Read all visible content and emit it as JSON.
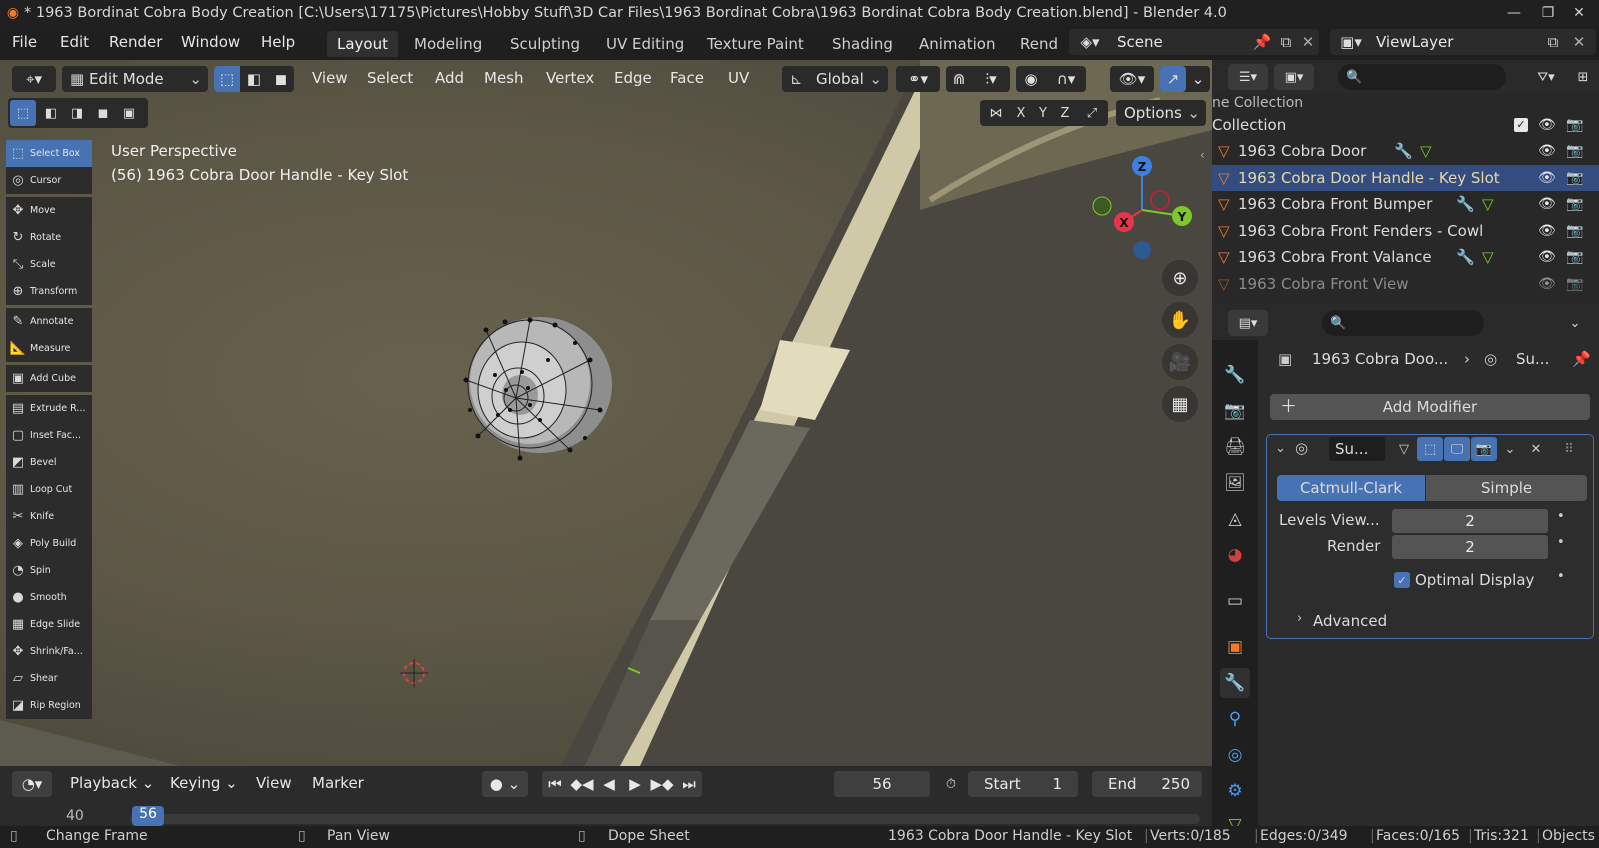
{
  "window": {
    "title": "* 1963 Bordinat Cobra Body Creation [C:\\Users\\17175\\Pictures\\Hobby Stuff\\3D Car Files\\1963 Bordinat Cobra\\1963 Bordinat Cobra Body Creation.blend] - Blender 4.0",
    "controls": [
      "—",
      "❐",
      "✕"
    ]
  },
  "menu": [
    "File",
    "Edit",
    "Render",
    "Window",
    "Help"
  ],
  "workspaces": [
    "Layout",
    "Modeling",
    "Sculpting",
    "UV Editing",
    "Texture Paint",
    "Shading",
    "Animation",
    "Rend"
  ],
  "active_workspace": "Layout",
  "scene": "Scene",
  "view_layer": "ViewLayer",
  "viewport": {
    "mode": "Edit Mode",
    "menus": [
      "View",
      "Select",
      "Add",
      "Mesh",
      "Vertex",
      "Edge",
      "Face",
      "UV"
    ],
    "orientation": "Global",
    "options_label": "Options",
    "axes_toggle": [
      "X",
      "Y",
      "Z"
    ],
    "info_line1": "User Perspective",
    "info_line2": "(56) 1963 Cobra Door Handle - Key Slot",
    "gizmo": {
      "x": "X",
      "y": "Y",
      "z": "Z"
    }
  },
  "tools": [
    {
      "label": "Select Box",
      "icon": "select-box-icon",
      "glyph": "⬚",
      "active": true
    },
    {
      "label": "Cursor",
      "icon": "cursor-icon",
      "glyph": "◎"
    },
    {
      "gap": true
    },
    {
      "label": "Move",
      "icon": "move-icon",
      "glyph": "✥"
    },
    {
      "label": "Rotate",
      "icon": "rotate-icon",
      "glyph": "↻"
    },
    {
      "label": "Scale",
      "icon": "scale-icon",
      "glyph": "⤡"
    },
    {
      "label": "Transform",
      "icon": "transform-icon",
      "glyph": "⊕"
    },
    {
      "gap": true
    },
    {
      "label": "Annotate",
      "icon": "annotate-icon",
      "glyph": "✎"
    },
    {
      "label": "Measure",
      "icon": "measure-icon",
      "glyph": "📐"
    },
    {
      "gap": true
    },
    {
      "label": "Add Cube",
      "icon": "add-cube-icon",
      "glyph": "▣"
    },
    {
      "gap": true
    },
    {
      "label": "Extrude R...",
      "icon": "extrude-icon",
      "glyph": "▤"
    },
    {
      "label": "Inset Fac...",
      "icon": "inset-icon",
      "glyph": "▢"
    },
    {
      "label": "Bevel",
      "icon": "bevel-icon",
      "glyph": "◩"
    },
    {
      "label": "Loop Cut",
      "icon": "loop-cut-icon",
      "glyph": "▥"
    },
    {
      "label": "Knife",
      "icon": "knife-icon",
      "glyph": "✂"
    },
    {
      "label": "Poly Build",
      "icon": "poly-build-icon",
      "glyph": "◈"
    },
    {
      "label": "Spin",
      "icon": "spin-icon",
      "glyph": "◔"
    },
    {
      "label": "Smooth",
      "icon": "smooth-icon",
      "glyph": "●"
    },
    {
      "label": "Edge Slide",
      "icon": "edge-slide-icon",
      "glyph": "▦"
    },
    {
      "label": "Shrink/Fa...",
      "icon": "shrink-icon",
      "glyph": "✥"
    },
    {
      "label": "Shear",
      "icon": "shear-icon",
      "glyph": "▱"
    },
    {
      "label": "Rip Region",
      "icon": "rip-icon",
      "glyph": "◪"
    }
  ],
  "outliner": {
    "header_partial": "ne Collection",
    "collection": "Collection",
    "items": [
      {
        "name": "1963 Cobra Door",
        "selected": false,
        "mod": true,
        "mesh": true
      },
      {
        "name": "1963 Cobra Door Handle - Key Slot",
        "selected": true,
        "mod": false,
        "mesh": false
      },
      {
        "name": "1963 Cobra Front Bumper",
        "selected": false,
        "mod": true,
        "mesh": true
      },
      {
        "name": "1963 Cobra Front Fenders - Cowl",
        "selected": false,
        "mod": false,
        "mesh": false
      },
      {
        "name": "1963 Cobra Front Valance",
        "selected": false,
        "mod": true,
        "mesh": true
      },
      {
        "name": "1963 Cobra Front View",
        "selected": false,
        "mod": false,
        "mesh": false,
        "dim": true
      }
    ]
  },
  "properties": {
    "breadcrumb_object": "1963 Cobra Doo...",
    "breadcrumb_modifier": "Su...",
    "add_modifier": "Add Modifier",
    "modifier_name": "Su...",
    "subdiv_types": [
      "Catmull-Clark",
      "Simple"
    ],
    "active_type": "Catmull-Clark",
    "levels_viewport_label": "Levels View...",
    "levels_viewport": "2",
    "render_label": "Render",
    "render_levels": "2",
    "optimal_display_label": "Optimal Display",
    "optimal_display": true,
    "advanced_label": "Advanced"
  },
  "timeline": {
    "menus": [
      "Playback",
      "Keying",
      "View",
      "Marker"
    ],
    "current_frame": "56",
    "start_label": "Start",
    "start": "1",
    "end_label": "End",
    "end": "250",
    "ruler_start": "40",
    "playhead": "56"
  },
  "status": {
    "hint1": "Change Frame",
    "hint2": "Pan View",
    "hint3": "Dope Sheet",
    "object": "1963 Cobra Door Handle - Key Slot",
    "verts": "Verts:0/185",
    "edges": "Edges:0/349",
    "faces": "Faces:0/165",
    "tris": "Tris:321",
    "objects": "Objects"
  },
  "colors": {
    "accent": "#4772b3",
    "selected_row": "#334d80",
    "orange": "#f5792a",
    "axis_x": "#e8344b",
    "axis_y": "#7ec82a",
    "axis_z": "#3b82e0"
  }
}
